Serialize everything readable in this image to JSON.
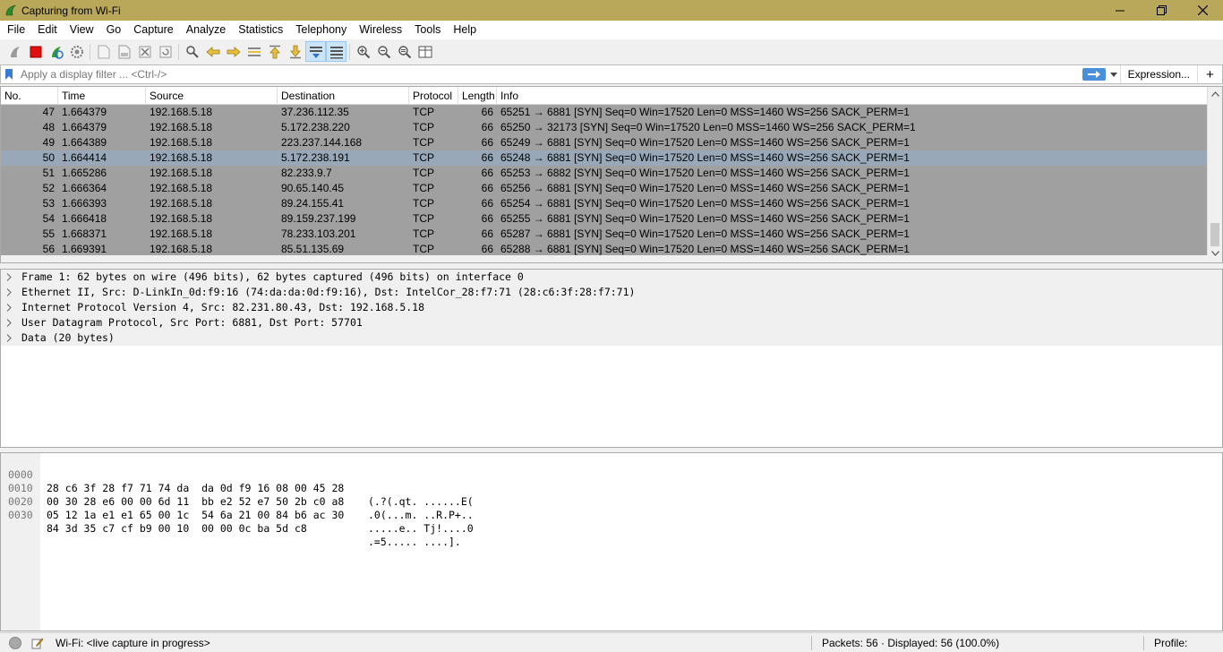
{
  "window": {
    "title": "Capturing from Wi-Fi"
  },
  "menu": [
    "File",
    "Edit",
    "View",
    "Go",
    "Capture",
    "Analyze",
    "Statistics",
    "Telephony",
    "Wireless",
    "Tools",
    "Help"
  ],
  "filter": {
    "placeholder": "Apply a display filter ... <Ctrl-/>",
    "expression_label": "Expression...",
    "plus_label": "+"
  },
  "packet_list": {
    "columns": [
      "No.",
      "Time",
      "Source",
      "Destination",
      "Protocol",
      "Length",
      "Info"
    ],
    "rows": [
      {
        "no": "47",
        "time": "1.664379",
        "src": "192.168.5.18",
        "dst": "37.236.112.35",
        "proto": "TCP",
        "len": "66",
        "info": "65251 → 6881 [SYN] Seq=0 Win=17520 Len=0 MSS=1460 WS=256 SACK_PERM=1"
      },
      {
        "no": "48",
        "time": "1.664379",
        "src": "192.168.5.18",
        "dst": "5.172.238.220",
        "proto": "TCP",
        "len": "66",
        "info": "65250 → 32173 [SYN] Seq=0 Win=17520 Len=0 MSS=1460 WS=256 SACK_PERM=1"
      },
      {
        "no": "49",
        "time": "1.664389",
        "src": "192.168.5.18",
        "dst": "223.237.144.168",
        "proto": "TCP",
        "len": "66",
        "info": "65249 → 6881 [SYN] Seq=0 Win=17520 Len=0 MSS=1460 WS=256 SACK_PERM=1"
      },
      {
        "no": "50",
        "time": "1.664414",
        "src": "192.168.5.18",
        "dst": "5.172.238.191",
        "proto": "TCP",
        "len": "66",
        "info": "65248 → 6881 [SYN] Seq=0 Win=17520 Len=0 MSS=1460 WS=256 SACK_PERM=1",
        "selected": true
      },
      {
        "no": "51",
        "time": "1.665286",
        "src": "192.168.5.18",
        "dst": "82.233.9.7",
        "proto": "TCP",
        "len": "66",
        "info": "65253 → 6882 [SYN] Seq=0 Win=17520 Len=0 MSS=1460 WS=256 SACK_PERM=1"
      },
      {
        "no": "52",
        "time": "1.666364",
        "src": "192.168.5.18",
        "dst": "90.65.140.45",
        "proto": "TCP",
        "len": "66",
        "info": "65256 → 6881 [SYN] Seq=0 Win=17520 Len=0 MSS=1460 WS=256 SACK_PERM=1"
      },
      {
        "no": "53",
        "time": "1.666393",
        "src": "192.168.5.18",
        "dst": "89.24.155.41",
        "proto": "TCP",
        "len": "66",
        "info": "65254 → 6881 [SYN] Seq=0 Win=17520 Len=0 MSS=1460 WS=256 SACK_PERM=1"
      },
      {
        "no": "54",
        "time": "1.666418",
        "src": "192.168.5.18",
        "dst": "89.159.237.199",
        "proto": "TCP",
        "len": "66",
        "info": "65255 → 6881 [SYN] Seq=0 Win=17520 Len=0 MSS=1460 WS=256 SACK_PERM=1"
      },
      {
        "no": "55",
        "time": "1.668371",
        "src": "192.168.5.18",
        "dst": "78.233.103.201",
        "proto": "TCP",
        "len": "66",
        "info": "65287 → 6881 [SYN] Seq=0 Win=17520 Len=0 MSS=1460 WS=256 SACK_PERM=1"
      },
      {
        "no": "56",
        "time": "1.669391",
        "src": "192.168.5.18",
        "dst": "85.51.135.69",
        "proto": "TCP",
        "len": "66",
        "info": "65288 → 6881 [SYN] Seq=0 Win=17520 Len=0 MSS=1460 WS=256 SACK_PERM=1"
      }
    ]
  },
  "details": [
    "Frame 1: 62 bytes on wire (496 bits), 62 bytes captured (496 bits) on interface 0",
    "Ethernet II, Src: D-LinkIn_0d:f9:16 (74:da:da:0d:f9:16), Dst: IntelCor_28:f7:71 (28:c6:3f:28:f7:71)",
    "Internet Protocol Version 4, Src: 82.231.80.43, Dst: 192.168.5.18",
    "User Datagram Protocol, Src Port: 6881, Dst Port: 57701",
    "Data (20 bytes)"
  ],
  "bytes": [
    {
      "offset": "0000",
      "hex": "28 c6 3f 28 f7 71 74 da  da 0d f9 16 08 00 45 28",
      "ascii": "(.?(.qt. ......E("
    },
    {
      "offset": "0010",
      "hex": "00 30 28 e6 00 00 6d 11  bb e2 52 e7 50 2b c0 a8",
      "ascii": ".0(...m. ..R.P+.."
    },
    {
      "offset": "0020",
      "hex": "05 12 1a e1 e1 65 00 1c  54 6a 21 00 84 b6 ac 30",
      "ascii": ".....e.. Tj!....0"
    },
    {
      "offset": "0030",
      "hex": "84 3d 35 c7 cf b9 00 10  00 00 0c ba 5d c8",
      "ascii": ".=5..... ....]."
    }
  ],
  "status": {
    "capture_text": "Wi-Fi: <live capture in progress>",
    "packets_text": "Packets: 56 · Displayed: 56 (100.0%)",
    "profile_text": "Profile: Default"
  },
  "colors": {
    "titlebar": "#b9a85a",
    "row_bg": "#a0a0a0",
    "row_selected": "#98a8b8",
    "accent": "#4a90d9"
  }
}
